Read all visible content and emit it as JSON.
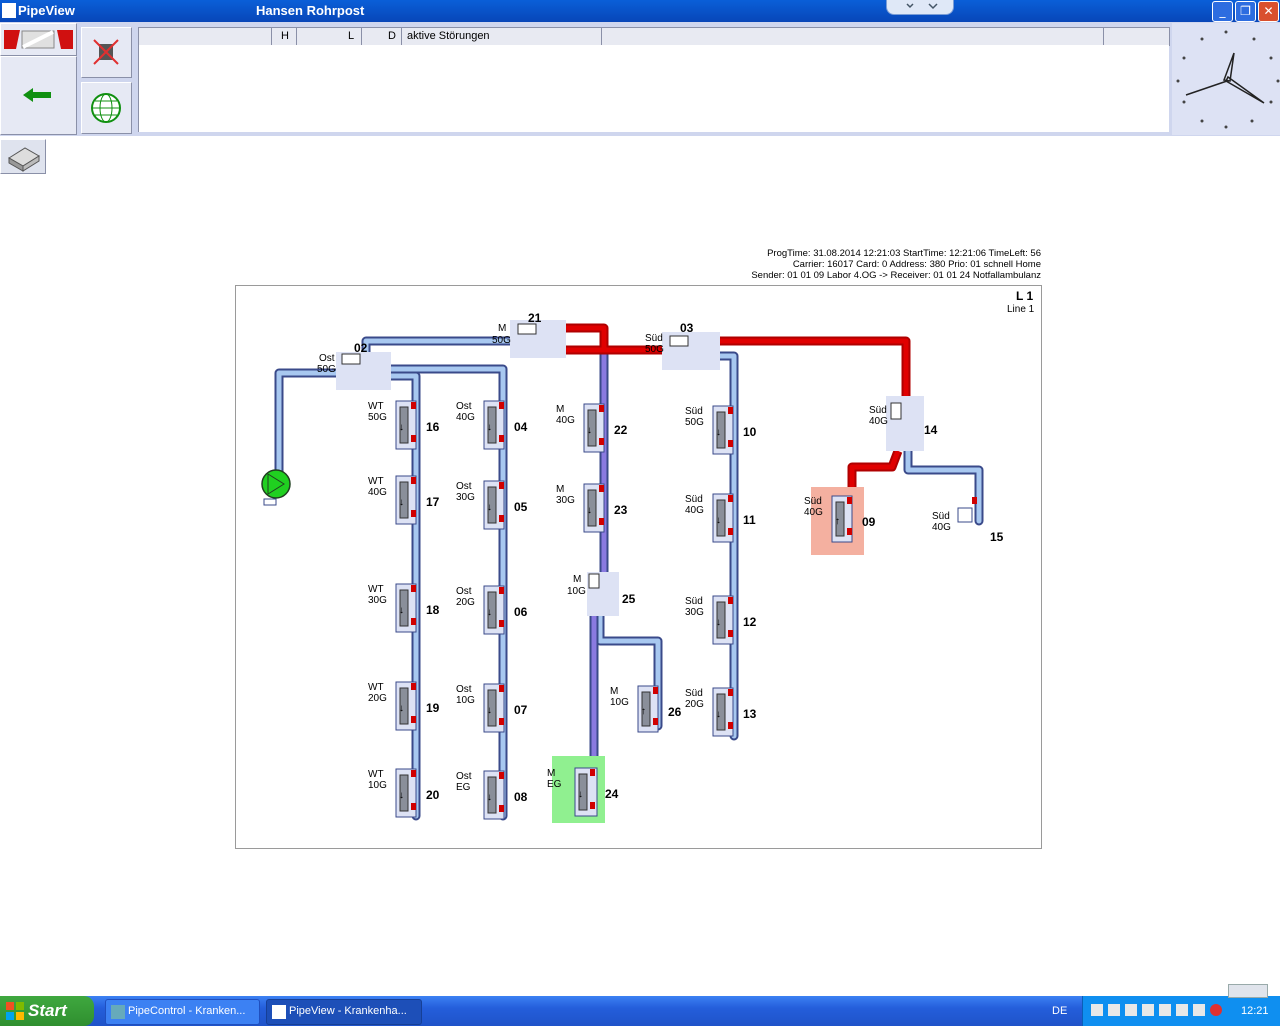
{
  "window": {
    "app_title": "PipeView",
    "subtitle": "Hansen Rohrpost"
  },
  "window_buttons": {
    "minimize": "_",
    "maximize": "❐",
    "close": "✕"
  },
  "list": {
    "col_h": "H",
    "col_l": "L",
    "col_d": "D",
    "col_status": "aktive Störungen"
  },
  "info": {
    "line1": "ProgTime: 31.08.2014 12:21:03 StartTime: 12:21:06 TimeLeft: 56",
    "line2": "Carrier: 16017 Card: 0 Address: 380 Prio: 01 schnell Home",
    "line3": "Sender: 01 01 09 Labor 4.OG -> Receiver: 01 01 24 Notfallambulanz"
  },
  "line": {
    "id": "L 1",
    "name": "Line 1"
  },
  "stations": [
    {
      "id": "16",
      "l1": "WT",
      "l2": "50G"
    },
    {
      "id": "17",
      "l1": "WT",
      "l2": "40G"
    },
    {
      "id": "18",
      "l1": "WT",
      "l2": "30G"
    },
    {
      "id": "19",
      "l1": "WT",
      "l2": "20G"
    },
    {
      "id": "20",
      "l1": "WT",
      "l2": "10G"
    },
    {
      "id": "04",
      "l1": "Ost",
      "l2": "40G"
    },
    {
      "id": "05",
      "l1": "Ost",
      "l2": "30G"
    },
    {
      "id": "06",
      "l1": "Ost",
      "l2": "20G"
    },
    {
      "id": "07",
      "l1": "Ost",
      "l2": "10G"
    },
    {
      "id": "08",
      "l1": "Ost",
      "l2": "EG"
    },
    {
      "id": "22",
      "l1": "M",
      "l2": "40G"
    },
    {
      "id": "23",
      "l1": "M",
      "l2": "30G"
    },
    {
      "id": "26",
      "l1": "M",
      "l2": "10G"
    },
    {
      "id": "24",
      "l1": "M",
      "l2": "EG"
    },
    {
      "id": "10",
      "l1": "Süd",
      "l2": "50G"
    },
    {
      "id": "11",
      "l1": "Süd",
      "l2": "40G"
    },
    {
      "id": "12",
      "l1": "Süd",
      "l2": "30G"
    },
    {
      "id": "13",
      "l1": "Süd",
      "l2": "20G"
    },
    {
      "id": "09",
      "l1": "Süd",
      "l2": "40G"
    },
    {
      "id": "15",
      "l1": "Süd",
      "l2": "40G"
    }
  ],
  "diverters": [
    {
      "id": "02",
      "l1": "Ost",
      "l2": "50G"
    },
    {
      "id": "21",
      "l1": "M",
      "l2": "50G"
    },
    {
      "id": "03",
      "l1": "Süd",
      "l2": "50G"
    },
    {
      "id": "14",
      "l1": "Süd",
      "l2": "40G"
    },
    {
      "id": "25",
      "l1": "M",
      "l2": "10G"
    }
  ],
  "taskbar": {
    "start_label": "Start",
    "task1": "PipeControl - Kranken...",
    "task2": "PipeView - Krankenha...",
    "lang": "DE",
    "time": "12:21"
  },
  "colors": {
    "pipe": "#a8c8f0",
    "pipe_border": "#3a4a8a",
    "active": "#e00000",
    "route": "#8a7ae0",
    "sender_bg": "#f4b0a0",
    "receiver_bg": "#90f090",
    "blower": "#20d020"
  }
}
